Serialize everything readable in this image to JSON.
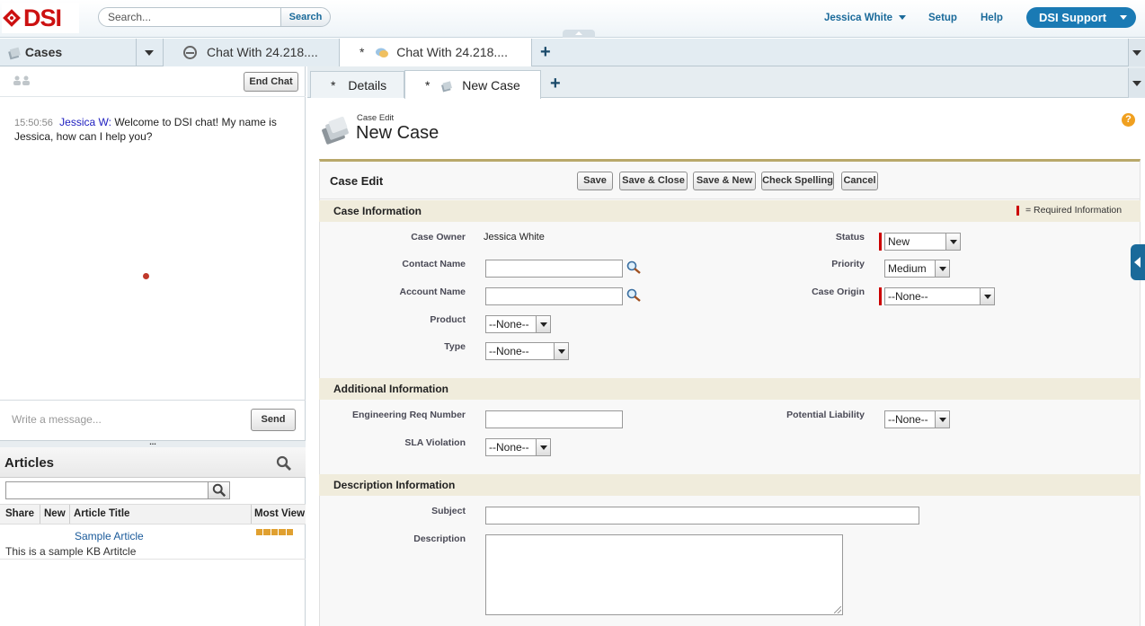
{
  "header": {
    "logo_text": "DSI",
    "search_placeholder": "Search...",
    "search_button": "Search",
    "user_menu": "Jessica White",
    "setup": "Setup",
    "help": "Help",
    "app_menu": "DSI Support"
  },
  "tabs": {
    "nav_tab": "Cases",
    "tab1": "Chat With 24.218....",
    "tab2": "Chat With 24.218....",
    "tab2_dirty": "*"
  },
  "subtabs": {
    "details": "Details",
    "details_dirty": "*",
    "new_case": "New Case",
    "new_case_dirty": "*"
  },
  "chat": {
    "end_chat": "End Chat",
    "message_time": "15:50:56",
    "message_author": "Jessica W:",
    "message_text": "Welcome to DSI chat! My name is Jessica, how can I help you?",
    "input_placeholder": "Write a message...",
    "send": "Send",
    "resize_handle": "..."
  },
  "articles": {
    "title": "Articles",
    "columns": [
      "Share",
      "New",
      "Article Title",
      "Most View"
    ],
    "rows": [
      {
        "title": "Sample Article",
        "summary": "This is a sample KB Artitcle"
      }
    ]
  },
  "case": {
    "breadcrumb": "Case Edit",
    "title": "New Case",
    "edit_header": "Case Edit",
    "buttons": {
      "save": "Save",
      "save_close": "Save & Close",
      "save_new": "Save & New",
      "check_spelling": "Check Spelling",
      "cancel": "Cancel"
    },
    "required_legend": "= Required Information",
    "sections": {
      "case_info": "Case Information",
      "additional": "Additional Information",
      "description": "Description Information"
    },
    "fields": {
      "case_owner_label": "Case Owner",
      "case_owner_value": "Jessica White",
      "contact_name_label": "Contact Name",
      "account_name_label": "Account Name",
      "product_label": "Product",
      "product_value": "--None--",
      "type_label": "Type",
      "type_value": "--None--",
      "status_label": "Status",
      "status_value": "New",
      "priority_label": "Priority",
      "priority_value": "Medium",
      "case_origin_label": "Case Origin",
      "case_origin_value": "--None--",
      "eng_req_label": "Engineering Req Number",
      "sla_label": "SLA Violation",
      "sla_value": "--None--",
      "potential_liability_label": "Potential Liability",
      "potential_liability_value": "--None--",
      "subject_label": "Subject",
      "description_label": "Description"
    }
  },
  "colors": {
    "accent": "#1a7ab4",
    "required": "#cc0000",
    "section_bg": "#f0ecdc",
    "logo_red": "#cc1111"
  }
}
